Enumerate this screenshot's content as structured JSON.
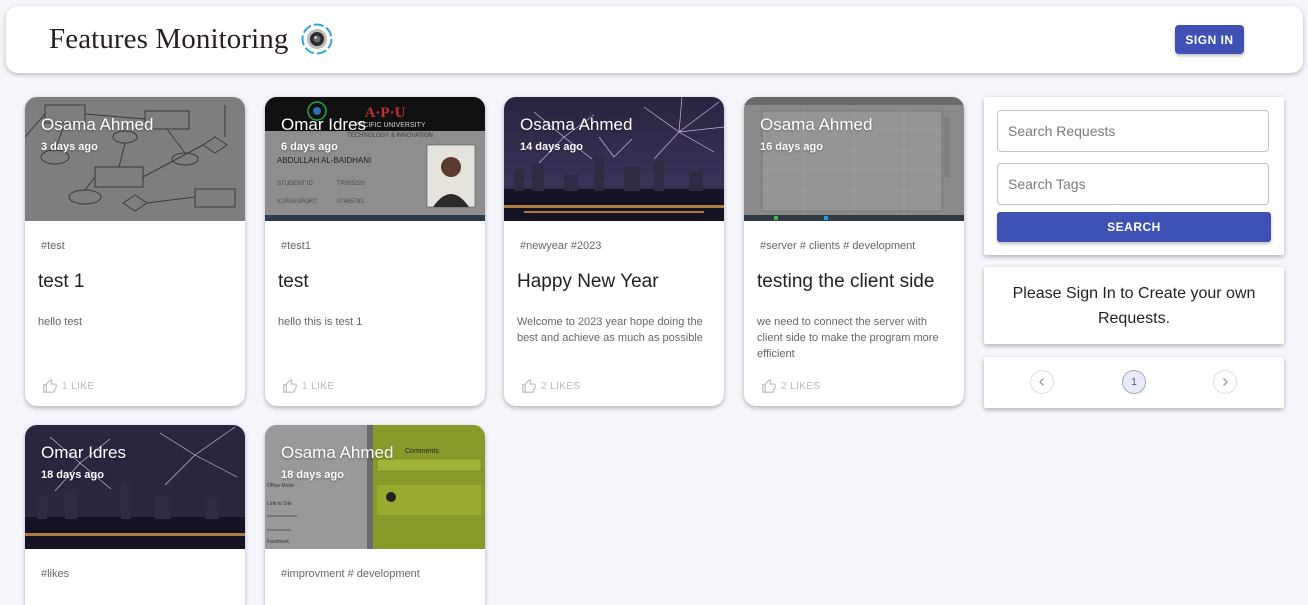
{
  "app": {
    "title": "Features Monitoring",
    "sign_in_label": "SIGN IN"
  },
  "cards": [
    {
      "author": "Osama Ahmed",
      "time": "3 days ago",
      "tags": "#test",
      "title": "test 1",
      "body": "hello test",
      "likes": "1 LIKE"
    },
    {
      "author": "Omar Idres",
      "time": "6 days ago",
      "tags": "#test1",
      "title": "test",
      "body": "hello this is test 1",
      "likes": "1 LIKE"
    },
    {
      "author": "Osama Ahmed",
      "time": "14 days ago",
      "tags": "#newyear #2023",
      "title": "Happy New Year",
      "body": "Welcome to 2023 year hope doing the best and achieve as much as possible",
      "likes": "2 LIKES"
    },
    {
      "author": "Osama Ahmed",
      "time": "16 days ago",
      "tags": "#server # clients # development",
      "title": "testing the client side",
      "body": "we need to connect the server with client side to make the program more efficient",
      "likes": "2 LIKES"
    },
    {
      "author": "Omar Idres",
      "time": "18 days ago",
      "tags": "#likes"
    },
    {
      "author": "Osama Ahmed",
      "time": "18 days ago",
      "tags": "#improvment # development"
    }
  ],
  "card_images": {
    "id_card_text": [
      "A·P·U",
      "PACIFIC UNIVERSITY",
      "TECHNOLOGY & INNOVATION",
      "ABDULLAH AL-BAIDHANI",
      "STUDENT ID:",
      "TP055229",
      "IC/PASSPORT:",
      "07485783"
    ],
    "doc_screenshot_text": [
      "Comments",
      "Office Mode",
      "Link to Site",
      "Facebook"
    ]
  },
  "search": {
    "requests_placeholder": "Search Requests",
    "tags_placeholder": "Search Tags",
    "button_label": "SEARCH"
  },
  "notice": "Please Sign In to Create your own Requests.",
  "pagination": {
    "current_page": "1",
    "prev_icon": "chevron-left-icon",
    "next_icon": "chevron-right-icon"
  },
  "colors": {
    "primary": "#3f51b5",
    "background": "#f5f6fb",
    "card": "#ffffff"
  }
}
